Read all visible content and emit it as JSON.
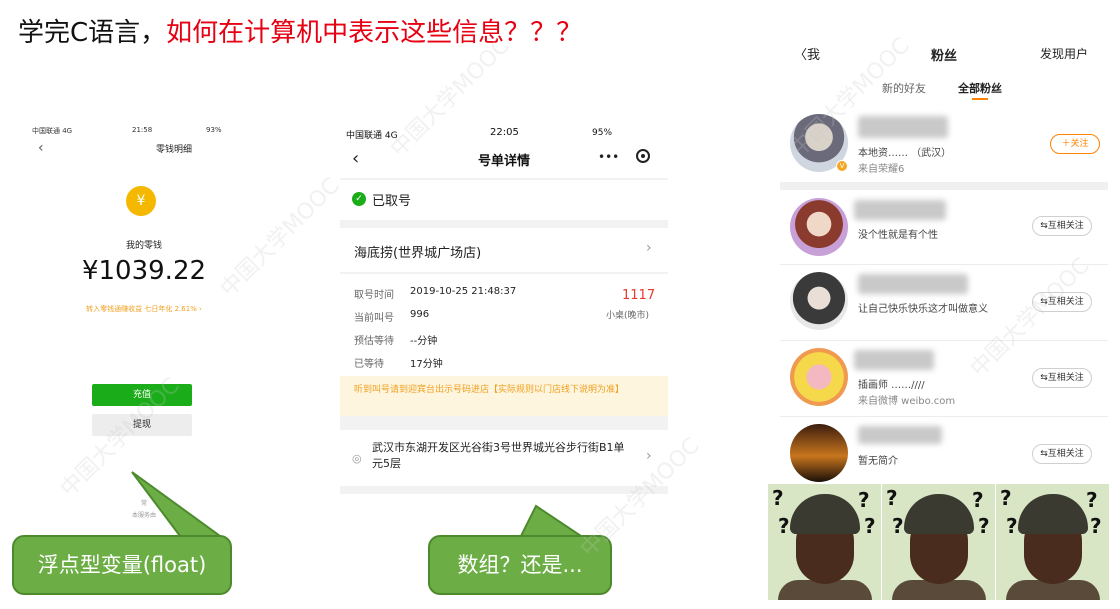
{
  "slide_title": {
    "part1": "学完C语言，",
    "part2": "如何在计算机中表示这些信息？？？"
  },
  "colors": {
    "title_red": "#e60012",
    "callout_green": "#6cae45",
    "wechat_green": "#1aad19",
    "weibo_orange": "#ff8200"
  },
  "wallet": {
    "status_carrier": "中国联通 4G",
    "status_time": "21:58",
    "status_battery": "93%",
    "title": "零钱明细",
    "coin_icon": "¥",
    "balance_label": "我的零钱",
    "balance": "¥1039.22",
    "promo": "转入零钱通赚收益 七日年化 2.61% ›",
    "recharge_button": "充值",
    "withdraw_button": "提现",
    "footer1": "常",
    "footer2": "本服务由"
  },
  "queue": {
    "status_carrier": "中国联通 4G",
    "status_time": "22:05",
    "status_battery": "95%",
    "title": "号单详情",
    "more_icon": "•••",
    "status": "已取号",
    "store": "海底捞(世界城广场店)",
    "rows": [
      {
        "key": "取号时间",
        "value": "2019-10-25 21:48:37"
      },
      {
        "key": "当前叫号",
        "value": "996"
      },
      {
        "key": "预估等待",
        "value": "--分钟"
      },
      {
        "key": "已等待",
        "value": "17分钟"
      }
    ],
    "ticket_number": "1117",
    "table_type": "小桌(晚市)",
    "tip": "听到叫号请到迎宾台出示号码进店【实际规则以门店线下说明为准】",
    "address": "武汉市东湖开发区光谷街3号世界城光谷步行街B1单元5层"
  },
  "fans": {
    "back_label": "〈我",
    "title": "粉丝",
    "discover": "发现用户",
    "tabs": [
      "新的好友",
      "全部粉丝"
    ],
    "items": [
      {
        "desc": "本地资…… （武汉）",
        "sub": "来自荣耀6",
        "button": "＋关注"
      },
      {
        "desc": "没个性就是有个性",
        "sub": "",
        "button": "⇆互相关注"
      },
      {
        "desc": "让自己快乐快乐这才叫做意义",
        "sub": "",
        "button": "⇆互相关注"
      },
      {
        "desc": "插画师 ……////",
        "sub": "来自微博 weibo.com",
        "button": "⇆互相关注"
      },
      {
        "desc": "暂无简介",
        "sub": "",
        "button": "⇆互相关注"
      }
    ]
  },
  "callouts": {
    "left": "浮点型变量(float)",
    "middle": "数组？还是..."
  },
  "meme_mark": "?",
  "watermark": "中国大学MOOC"
}
